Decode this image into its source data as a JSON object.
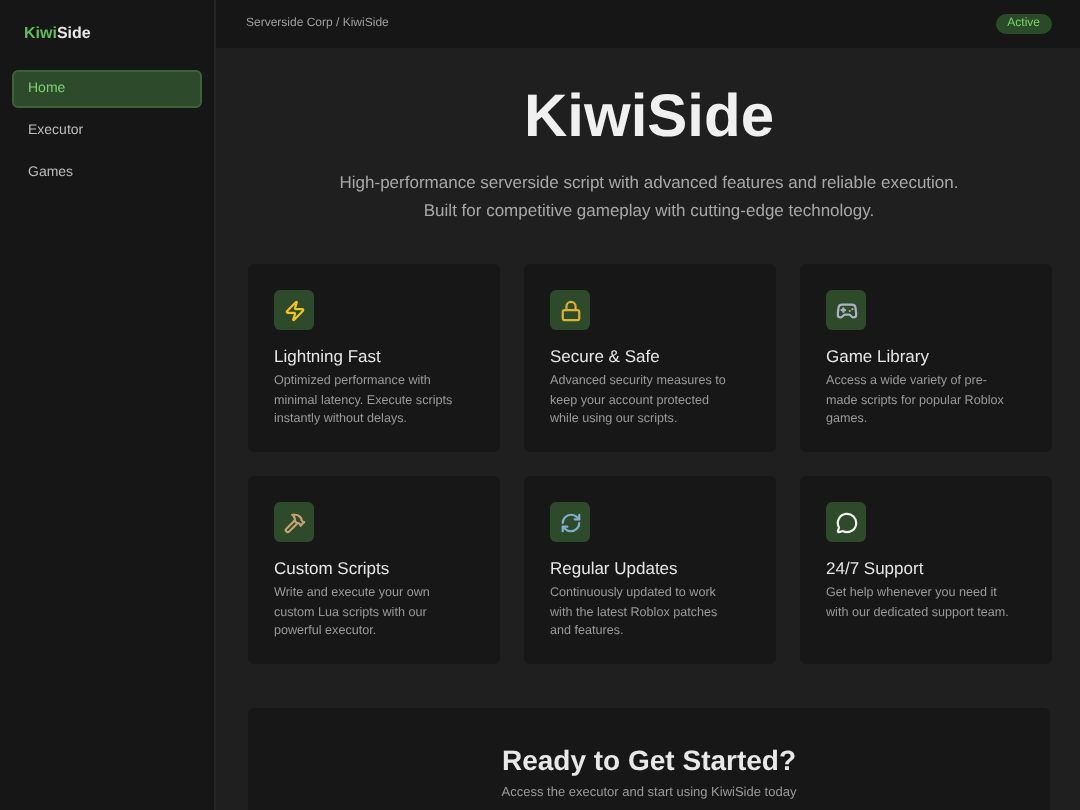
{
  "logo": {
    "accent": "Kiwi",
    "rest": "Side"
  },
  "sidebar": {
    "items": [
      {
        "label": "Home",
        "selected": true
      },
      {
        "label": "Executor",
        "selected": false
      },
      {
        "label": "Games",
        "selected": false
      }
    ]
  },
  "header": {
    "breadcrumb": "Serverside Corp / KiwiSide",
    "status": "Active"
  },
  "hero": {
    "title": "KiwiSide",
    "subtitle": [
      "High-performance serverside script with advanced features and reliable execution.",
      "Built for competitive gameplay with cutting-edge technology."
    ]
  },
  "features": [
    {
      "title": "Lightning Fast",
      "description": "Optimized performance with minimal latency. Execute scripts instantly without delays."
    },
    {
      "title": "Secure & Safe",
      "description": "Advanced security measures to keep your account protected while using our scripts."
    },
    {
      "title": "Game Library",
      "description": "Access a wide variety of pre-made scripts for popular Roblox games."
    },
    {
      "title": "Custom Scripts",
      "description": "Write and execute your own custom Lua scripts with our powerful executor."
    },
    {
      "title": "Regular Updates",
      "description": "Continuously updated to work with the latest Roblox patches and features."
    },
    {
      "title": "24/7 Support",
      "description": "Get help whenever you need it with our dedicated support team."
    }
  ],
  "cta": {
    "title": "Ready to Get Started?",
    "text": "Access the executor and start using KiwiSide today"
  }
}
